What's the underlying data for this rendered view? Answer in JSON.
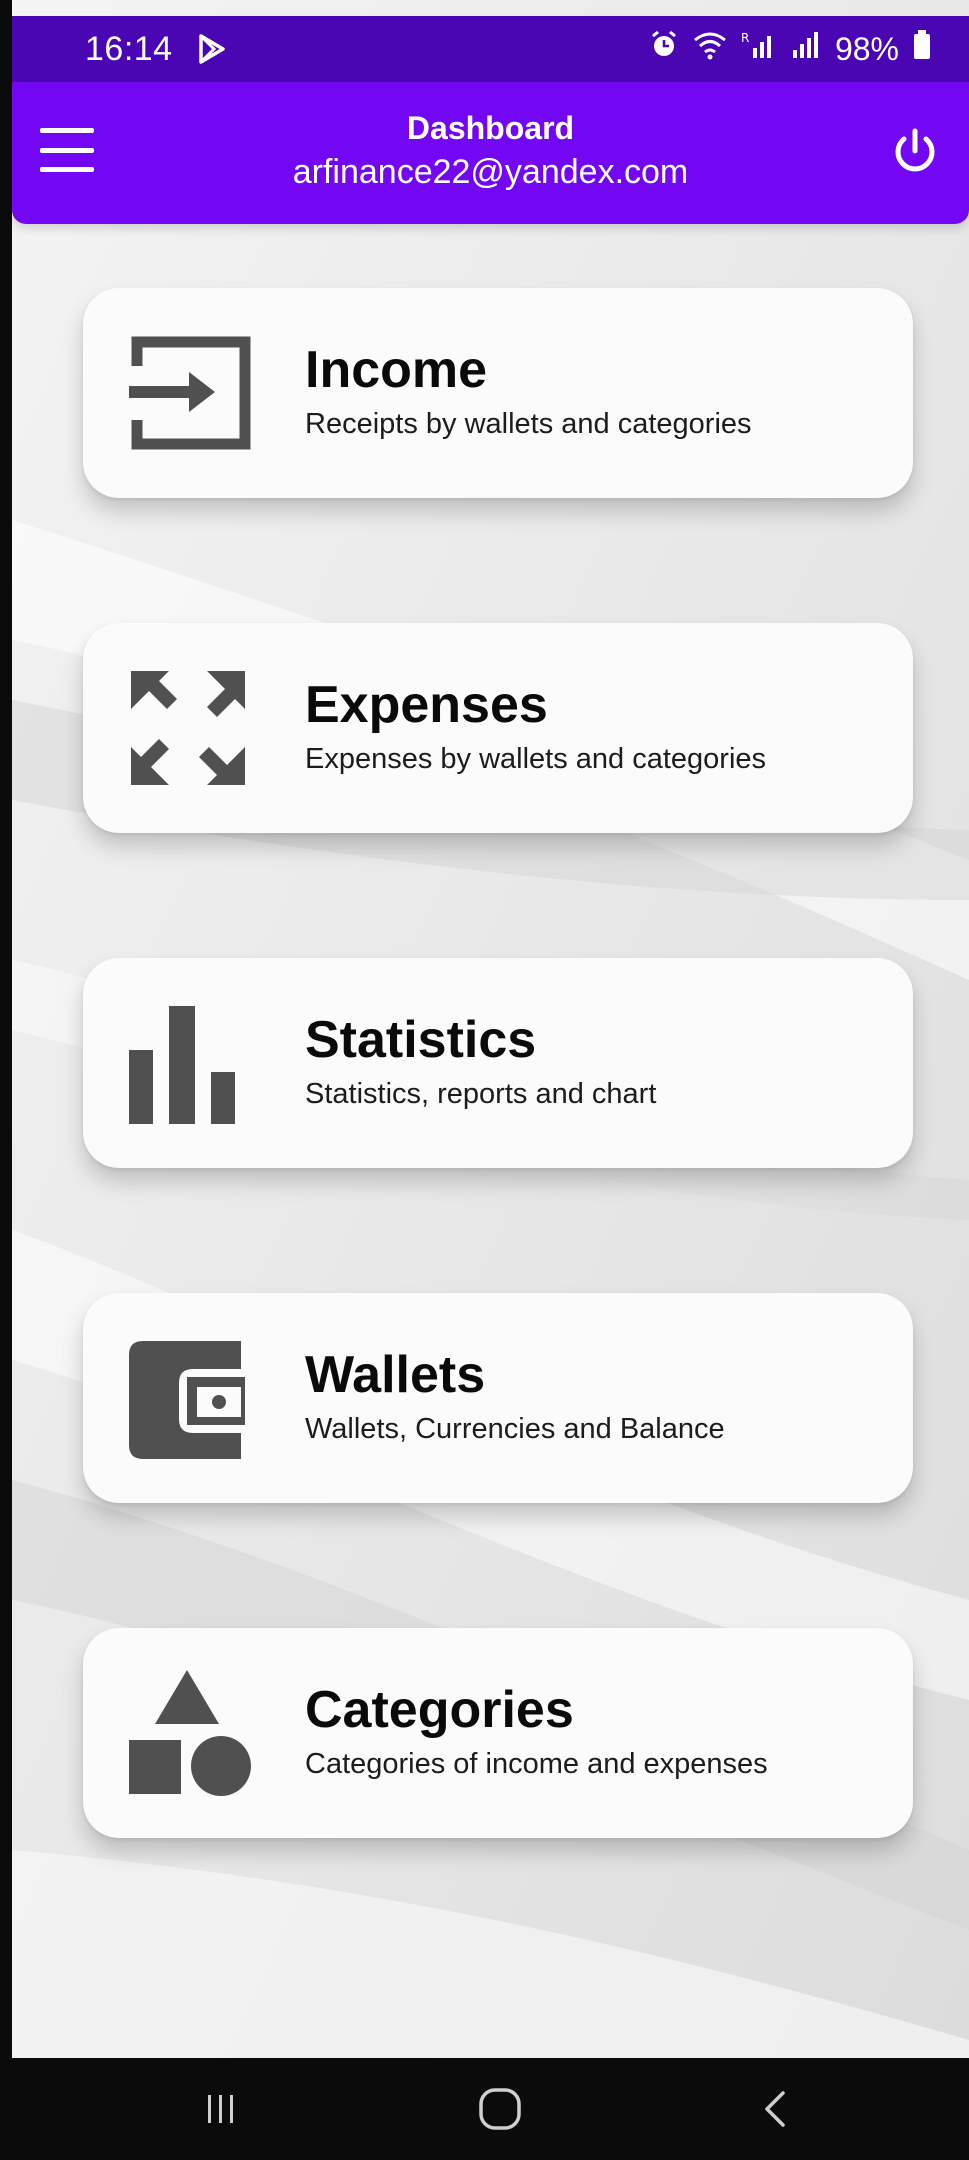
{
  "status_bar": {
    "time": "16:14",
    "battery": "98%",
    "icons": [
      "play-store-icon",
      "alarm-icon",
      "wifi-icon",
      "signal-icon",
      "signal-icon",
      "battery-icon"
    ]
  },
  "header": {
    "title": "Dashboard",
    "email": "arfinance22@yandex.com",
    "menu_icon": "hamburger-menu-icon",
    "power_icon": "power-icon"
  },
  "cards": [
    {
      "title": "Income",
      "description": "Receipts by wallets and categories",
      "icon": "income-input-icon"
    },
    {
      "title": "Expenses",
      "description": "Expenses by wallets and categories",
      "icon": "expand-arrows-icon"
    },
    {
      "title": "Statistics",
      "description": "Statistics, reports and chart",
      "icon": "bar-chart-icon"
    },
    {
      "title": "Wallets",
      "description": "Wallets, Currencies and Balance",
      "icon": "wallet-icon"
    },
    {
      "title": "Categories",
      "description": "Categories of income and expenses",
      "icon": "shapes-icon"
    }
  ],
  "colors": {
    "status_bar": "#4a06b3",
    "header": "#7307f3",
    "icon_gray": "#505050",
    "card": "#fbfbfb"
  },
  "nav_bar": {
    "buttons": [
      "recent-apps-icon",
      "home-icon",
      "back-icon"
    ]
  }
}
